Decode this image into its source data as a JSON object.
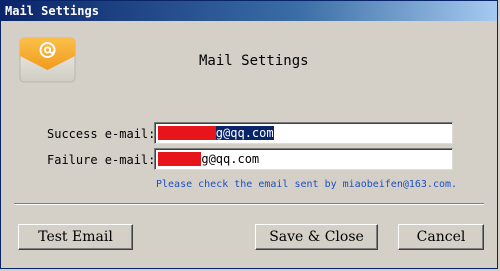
{
  "window": {
    "title": "Mail Settings"
  },
  "header": {
    "icon": "mail-envelope-icon",
    "title": "Mail Settings"
  },
  "form": {
    "success_label": "Success e-mail:",
    "success_redacted": "xxxxxxxx",
    "success_suffix": "g@qq.com",
    "failure_label": "Failure e-mail:",
    "failure_redacted": "xxxxxx",
    "failure_suffix": "g@qq.com",
    "hint": "Please check the email sent by miaobeifen@163.com."
  },
  "buttons": {
    "test": "Test Email",
    "save": "Save & Close",
    "cancel": "Cancel"
  },
  "colors": {
    "title_bar": "#0a246a",
    "hint_text": "#1d4fc4",
    "redaction": "#e6141b",
    "icon_orange": "#f5a623"
  }
}
